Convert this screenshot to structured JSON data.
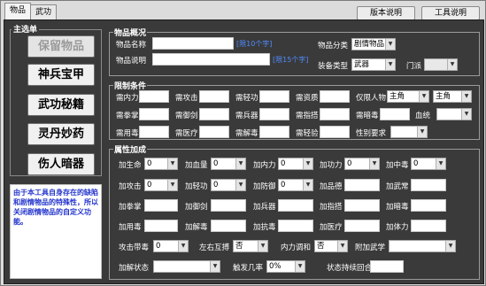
{
  "tabs": [
    "物品",
    "武功"
  ],
  "top_buttons": {
    "version": "版本说明",
    "tools": "工具说明"
  },
  "sidebar": {
    "title": "主选单",
    "buttons": [
      "保留物品",
      "神兵宝甲",
      "武功秘籍",
      "灵丹妙药",
      "伤人暗器"
    ],
    "note": "由于本工具自身存在的缺陷和剧情物品的特殊性，所以关闭剧情物品的自定义功能。"
  },
  "overview": {
    "title": "物品概况",
    "name_label": "物品名称",
    "name_hint": "[限10个字]",
    "desc_label": "物品说明",
    "desc_hint": "[限15个字]",
    "category_label": "物品分类",
    "category_value": "剧情物品",
    "equip_label": "装备类型",
    "equip_value": "武器",
    "faction_label": "门派",
    "faction_value": ""
  },
  "limits": {
    "title": "限制条件",
    "row1": [
      "需内力",
      "需攻击",
      "需轻功",
      "需资质"
    ],
    "row2": [
      "需拳掌",
      "需御剑",
      "需兵器",
      "需指搭",
      "需暗毒"
    ],
    "row3": [
      "需用毒",
      "需医疗",
      "需解毒",
      "需轻验"
    ],
    "rely_label": "仅限人物",
    "rely_value1": "主角",
    "rely_value2": "主角",
    "blood_label": "血统",
    "gender_label": "性别要求"
  },
  "attrs": {
    "title": "属性加成",
    "row1": [
      {
        "label": "加生命",
        "value": "0"
      },
      {
        "label": "加血量",
        "value": "0"
      },
      {
        "label": "加内力",
        "value": "0"
      },
      {
        "label": "加功力",
        "value": "0"
      },
      {
        "label": "加中毒",
        "value": "0"
      }
    ],
    "row2": [
      {
        "label": "加攻击",
        "value": "0"
      },
      {
        "label": "加轻功",
        "value": "0"
      },
      {
        "label": "加防御",
        "value": "0"
      }
    ],
    "row2_text": [
      "加品德",
      "加武常"
    ],
    "row3": [
      "加拳掌",
      "加御剑",
      "加兵器",
      "加指搭",
      "加暗毒"
    ],
    "row4": [
      "加用毒",
      "加解毒",
      "加抗毒",
      "加医疗",
      "加体力"
    ],
    "attack_type_label": "攻击带毒",
    "attack_type_value": "0",
    "lr_label": "左右互搏",
    "lr_value": "否",
    "inner_label": "内力调和",
    "inner_value": "否",
    "extra_label": "附加武学",
    "tan_label": "加解状态",
    "prob_label": "触发几率",
    "prob_value": "0%",
    "dur_label": "状态持续回合"
  }
}
